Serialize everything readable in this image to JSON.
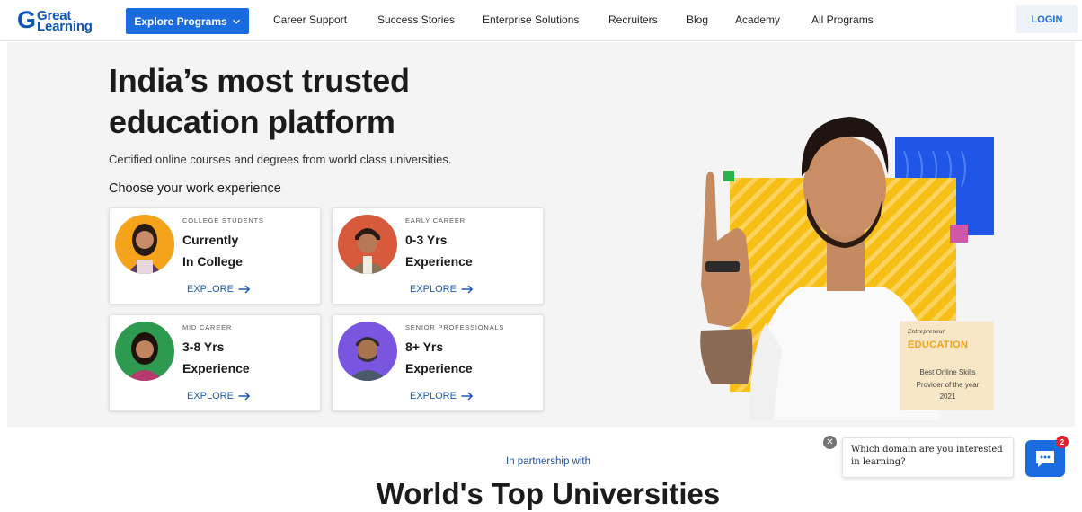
{
  "header": {
    "logo_line1": "Great",
    "logo_line2": "Learning",
    "explore_label": "Explore Programs",
    "nav": [
      "Career Support",
      "Success Stories",
      "Enterprise Solutions",
      "Recruiters",
      "Blog",
      "Academy",
      "All Programs"
    ],
    "login_label": "LOGIN"
  },
  "hero": {
    "title_line1": "India’s most trusted",
    "title_line2": "education platform",
    "subtitle": "Certified online courses and degrees from world class universities.",
    "choose_label": "Choose your work experience",
    "cards": [
      {
        "tag": "COLLEGE STUDENTS",
        "line1": "Currently",
        "line2": "In College",
        "cta": "EXPLORE"
      },
      {
        "tag": "EARLY CAREER",
        "line1": "0-3 Yrs",
        "line2": "Experience",
        "cta": "EXPLORE"
      },
      {
        "tag": "MID CAREER",
        "line1": "3-8 Yrs",
        "line2": "Experience",
        "cta": "EXPLORE"
      },
      {
        "tag": "SENIOR PROFESSIONALS",
        "line1": "8+ Yrs",
        "line2": "Experience",
        "cta": "EXPLORE"
      }
    ],
    "award": {
      "brand": "Entrepreneur",
      "badge_word": "EDUCATION",
      "line1": "Best Online Skills",
      "line2": "Provider of the year",
      "year": "2021"
    },
    "colors": {
      "accent": "#1a6be0",
      "yellow": "#f7be16",
      "blue_block": "#1f56e8",
      "green_square": "#27b24a",
      "pink_square": "#d357a8"
    }
  },
  "partners": {
    "kicker": "In partnership with",
    "heading": "World's Top Universities"
  },
  "chat": {
    "prompt": "Which domain are you interested in learning?",
    "badge_count": "2",
    "close_glyph": "✕"
  }
}
